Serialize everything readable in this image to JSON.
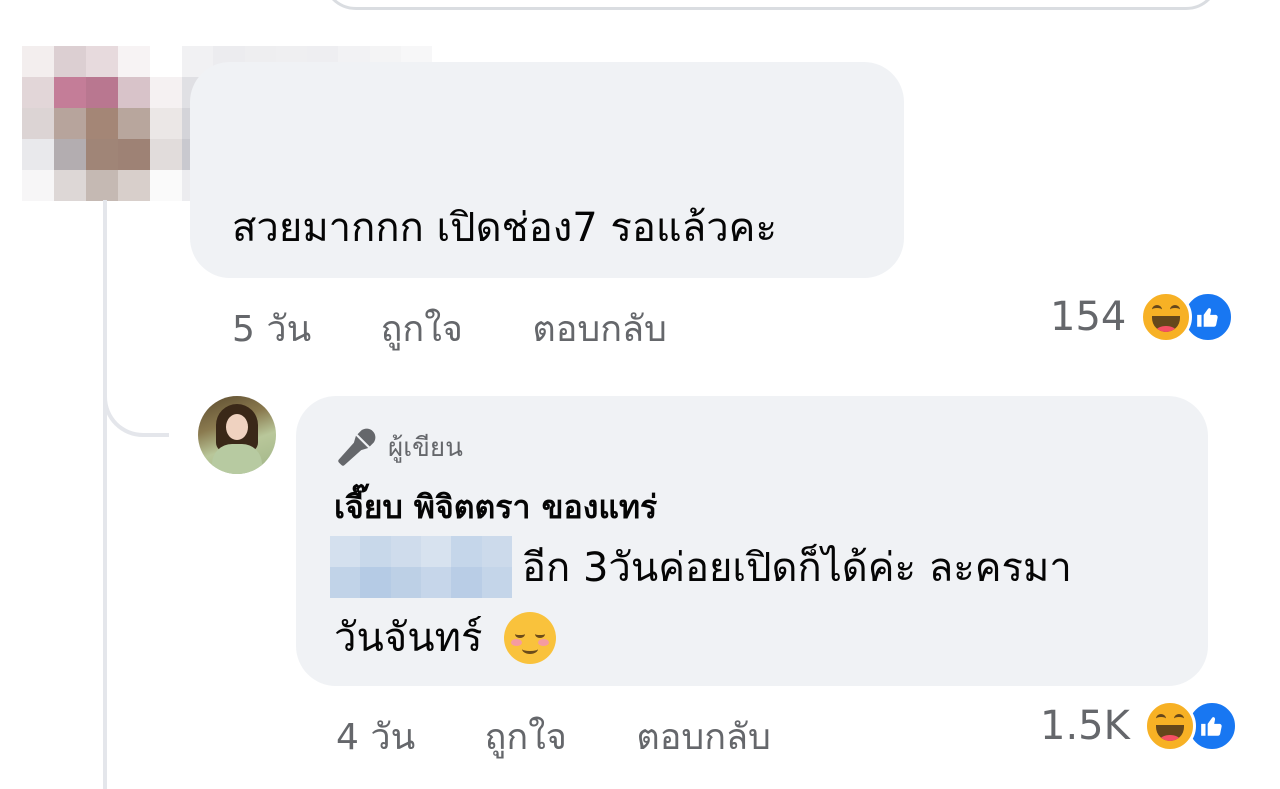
{
  "colors": {
    "bubble_bg": "#f0f2f5",
    "meta_text": "#65676b",
    "like_blue": "#1877f2",
    "haha_yellow": "#f7b125",
    "thread_line": "#e4e6eb"
  },
  "comment": {
    "text": "สวยมากกก เปิดช่อง7 รอแล้วคะ",
    "time": "5 วัน",
    "like_label": "ถูกใจ",
    "reply_label": "ตอบกลับ",
    "reaction_count": "154",
    "reaction_icons": [
      "haha-icon",
      "like-icon"
    ]
  },
  "reply": {
    "badge": "ผู้เขียน",
    "badge_icon": "microphone-icon",
    "author": "เจี๊ยบ พิจิตตรา ของแทร่",
    "text_line1": "อีก 3วันค่อยเปิดก็ได้ค่ะ ละครมา",
    "text_line2": "วันจันทร์",
    "emoji": "smiling-blush-emoji",
    "time": "4 วัน",
    "like_label": "ถูกใจ",
    "reply_label": "ตอบกลับ",
    "reaction_count": "1.5K",
    "reaction_icons": [
      "haha-icon",
      "like-icon"
    ]
  }
}
